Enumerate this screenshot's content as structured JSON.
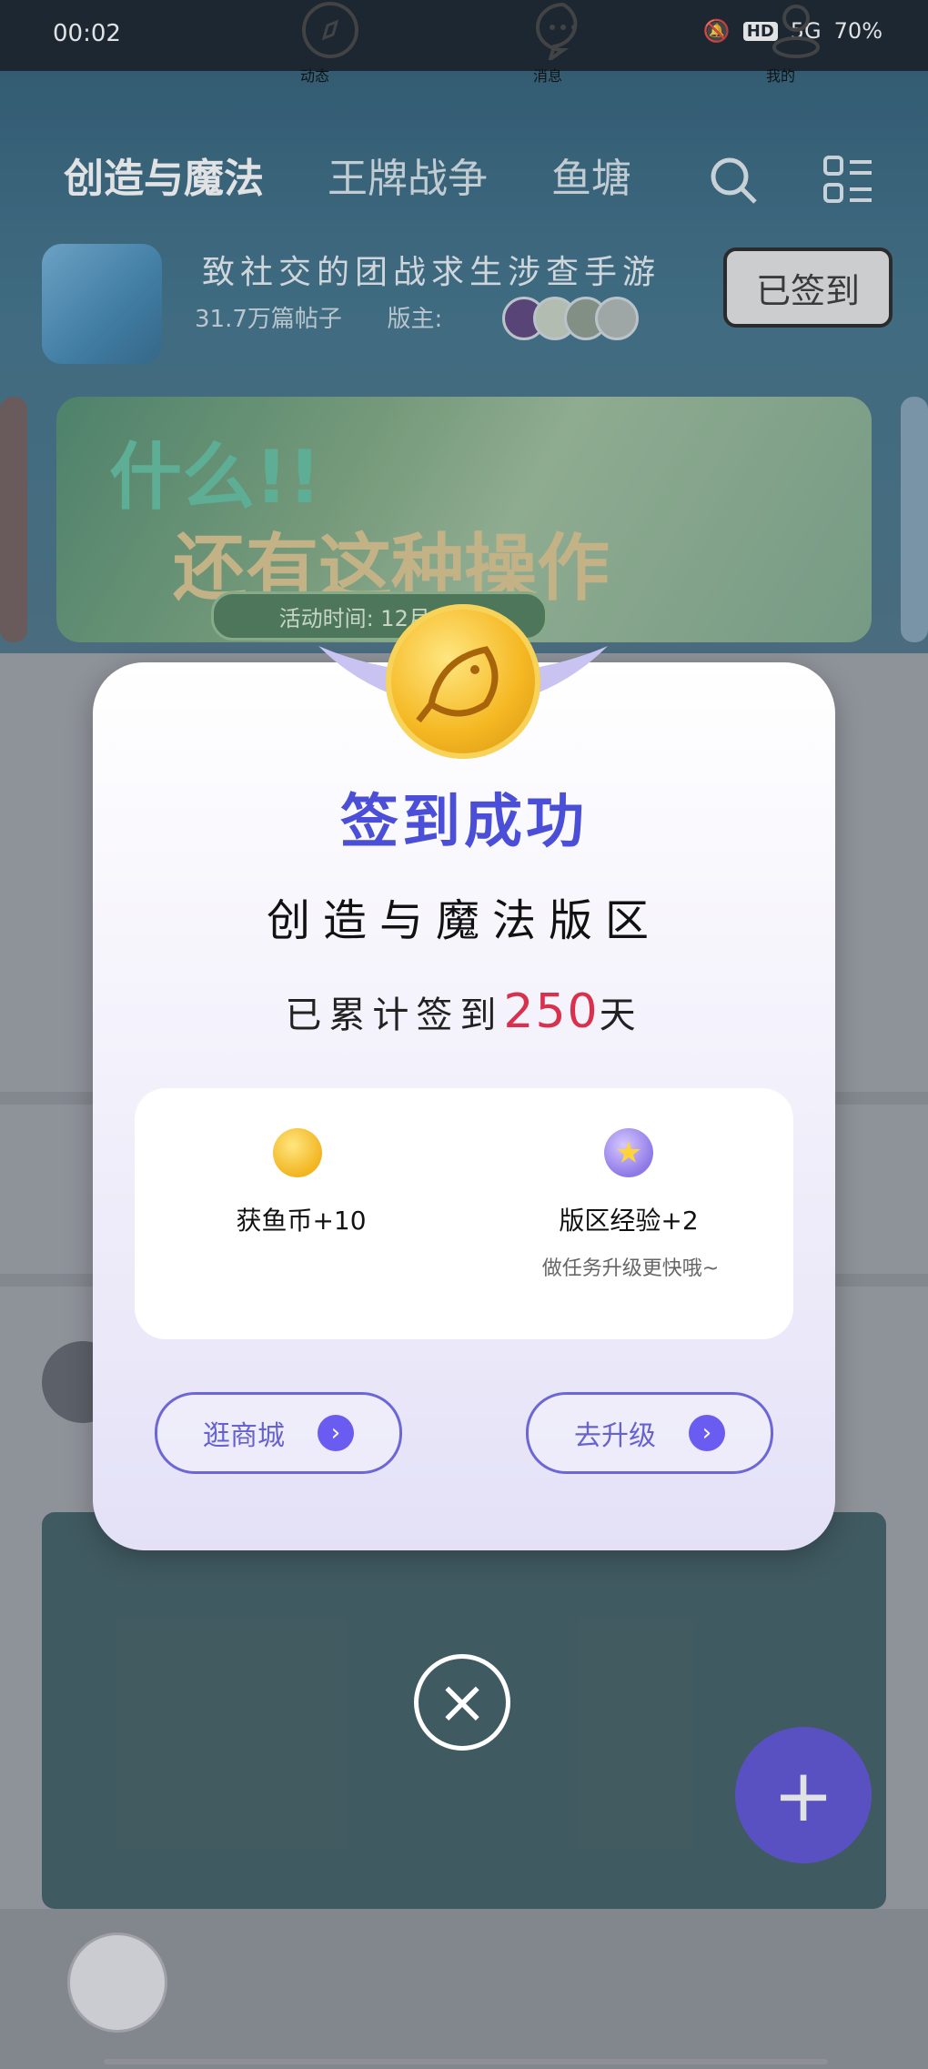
{
  "status_bar": {
    "time": "00:02",
    "hd": "HD",
    "network": "5G",
    "battery": "70%"
  },
  "top_nav": {
    "items": [
      "创造与魔法",
      "王牌战争",
      "鱼塘"
    ]
  },
  "game_header": {
    "title": "致社交的团战求生涉查手游",
    "subtitle": "31.7万篇帖子",
    "owner_label": "版主:",
    "checked_in_label": "已签到"
  },
  "banner": {
    "line1": "什么!!",
    "line2": "还有这种操作",
    "time_text": "活动时间: 12月15日"
  },
  "bottom_nav": {
    "items": [
      "动态",
      "消息",
      "我的"
    ]
  },
  "modal": {
    "title": "签到成功",
    "region": "创造与魔法版区",
    "days_prefix": "已累计签到",
    "days_count": "250",
    "days_suffix": "天",
    "reward1_label": "获鱼币+10",
    "reward2_label": "版区经验+2",
    "reward2_hint": "做任务升级更快哦~",
    "btn_shop": "逛商城",
    "btn_upgrade": "去升级",
    "colors": {
      "accent": "#4b4fd8",
      "highlight": "#d9304e"
    }
  }
}
